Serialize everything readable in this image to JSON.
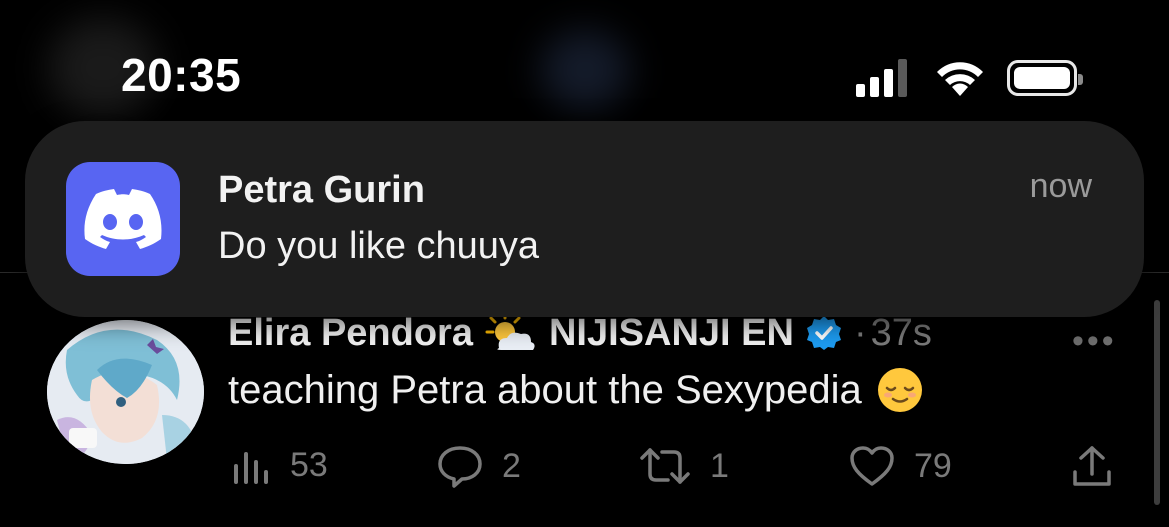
{
  "status_bar": {
    "time": "20:35",
    "signal_bars": 3,
    "signal_bars_total": 4,
    "wifi_icon": "wifi-icon",
    "battery_level": 1.0
  },
  "notification": {
    "app": "Discord",
    "app_icon": "discord-logo-icon",
    "app_color": "#5865f2",
    "title": "Petra Gurin",
    "body": "Do you like chuuya",
    "time": "now"
  },
  "tweet": {
    "display_name": "Elira Pendora",
    "name_emoji": "sun-behind-cloud-emoji",
    "affiliation": "NIJISANJI EN",
    "verified_icon": "verified-badge-icon",
    "separator": "·",
    "time_ago": "37s",
    "more_icon": "more-icon",
    "text": "teaching Petra about the Sexypedia",
    "text_emoji": "relieved-face-emoji",
    "stats": {
      "views": "53",
      "replies": "2",
      "retweets": "1",
      "likes": "79"
    }
  },
  "colors": {
    "background": "#000000",
    "banner": "#1e1e1e",
    "verified": "#1d9bf0",
    "muted_text": "#7a7a7a"
  }
}
